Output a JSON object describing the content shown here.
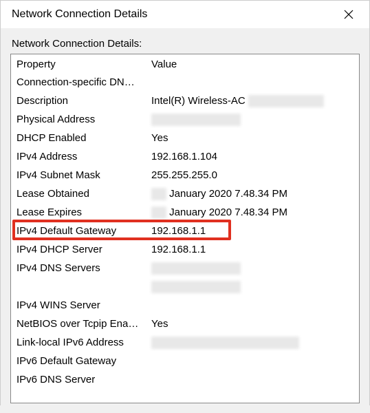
{
  "window": {
    "title": "Network Connection Details"
  },
  "content": {
    "label": "Network Connection Details:",
    "headers": {
      "property": "Property",
      "value": "Value"
    },
    "rows": [
      {
        "property": "Connection-specific DNS ...",
        "value": ""
      },
      {
        "property": "Description",
        "value": "Intel(R) Wireless-AC",
        "redactedAfter": true,
        "redactedWidth": 110
      },
      {
        "property": "Physical Address",
        "value": "",
        "redacted": true,
        "redactedWidth": 130
      },
      {
        "property": "DHCP Enabled",
        "value": "Yes"
      },
      {
        "property": "IPv4 Address",
        "value": "192.168.1.104"
      },
      {
        "property": "IPv4 Subnet Mask",
        "value": "255.255.255.0"
      },
      {
        "property": "Lease Obtained",
        "value": "January 2020 7.48.34 PM",
        "redactedBefore": true,
        "redactedBeforeWidth": 22
      },
      {
        "property": "Lease Expires",
        "value": "January 2020 7.48.34 PM",
        "redactedBefore": true,
        "redactedBeforeWidth": 22
      },
      {
        "property": "IPv4 Default Gateway",
        "value": "192.168.1.1",
        "highlighted": true
      },
      {
        "property": "IPv4 DHCP Server",
        "value": "192.168.1.1"
      },
      {
        "property": "IPv4 DNS Servers",
        "value": "",
        "redacted": true,
        "redactedWidth": 130
      },
      {
        "property": "",
        "value": "",
        "redacted": true,
        "redactedWidth": 130
      },
      {
        "property": "IPv4 WINS Server",
        "value": ""
      },
      {
        "property": "NetBIOS over Tcpip Enab...",
        "value": "Yes"
      },
      {
        "property": "Link-local IPv6 Address",
        "value": "",
        "redacted": true,
        "redactedWidth": 215
      },
      {
        "property": "IPv6 Default Gateway",
        "value": ""
      },
      {
        "property": "IPv6 DNS Server",
        "value": ""
      }
    ]
  }
}
